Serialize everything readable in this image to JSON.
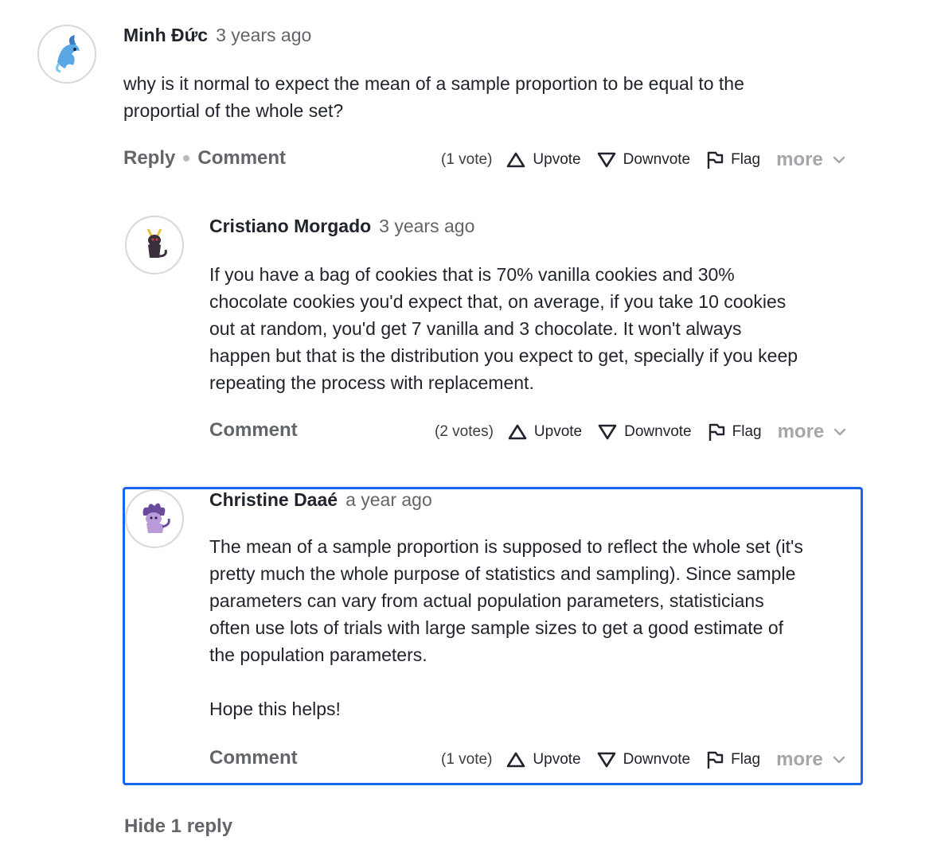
{
  "thread": {
    "question": {
      "author": "Minh Đức",
      "time": "3 years ago",
      "text_line1": "why is it normal to expect the mean of a sample proportion to be equal to the",
      "text_line2": "proportial of the whole set?",
      "reply_label": "Reply",
      "comment_label": "Comment",
      "votes": "(1 vote)",
      "upvote": "Upvote",
      "downvote": "Downvote",
      "flag": "Flag",
      "more": "more"
    },
    "answers": [
      {
        "author": "Cristiano Morgado",
        "time": "3 years ago",
        "lines": [
          "If you have a bag of cookies that is 70% vanilla cookies and 30%",
          "chocolate cookies you'd expect that, on average, if you take 10 cookies",
          "out at random, you'd get 7 vanilla and 3 chocolate. It won't always",
          "happen but that is the distribution you expect to get, specially if you keep",
          "repeating the process with replacement."
        ],
        "comment_label": "Comment",
        "votes": "(2 votes)",
        "upvote": "Upvote",
        "downvote": "Downvote",
        "flag": "Flag",
        "more": "more"
      },
      {
        "author": "Christine Daaé",
        "time": "a year ago",
        "lines": [
          "The mean of a sample proportion is supposed to reflect the whole set (it's",
          "pretty much the whole purpose of statistics and sampling). Since sample",
          "parameters can vary from actual population parameters, statisticians",
          "often use lots of trials with large sample sizes to get a good estimate of",
          "the population parameters.",
          "",
          "Hope this helps!"
        ],
        "comment_label": "Comment",
        "votes": "(1 vote)",
        "upvote": "Upvote",
        "downvote": "Downvote",
        "flag": "Flag",
        "more": "more"
      }
    ],
    "hide_replies_label": "Hide 1 reply"
  },
  "colors": {
    "focus_outline": "#1865f2",
    "muted_text": "#626569",
    "primary_text": "#21242c"
  },
  "icons": [
    "avatar-blue-creature-icon",
    "avatar-dark-creature-icon",
    "avatar-purple-creature-icon",
    "upvote-triangle-icon",
    "downvote-triangle-icon",
    "flag-icon",
    "chevron-down-icon"
  ]
}
